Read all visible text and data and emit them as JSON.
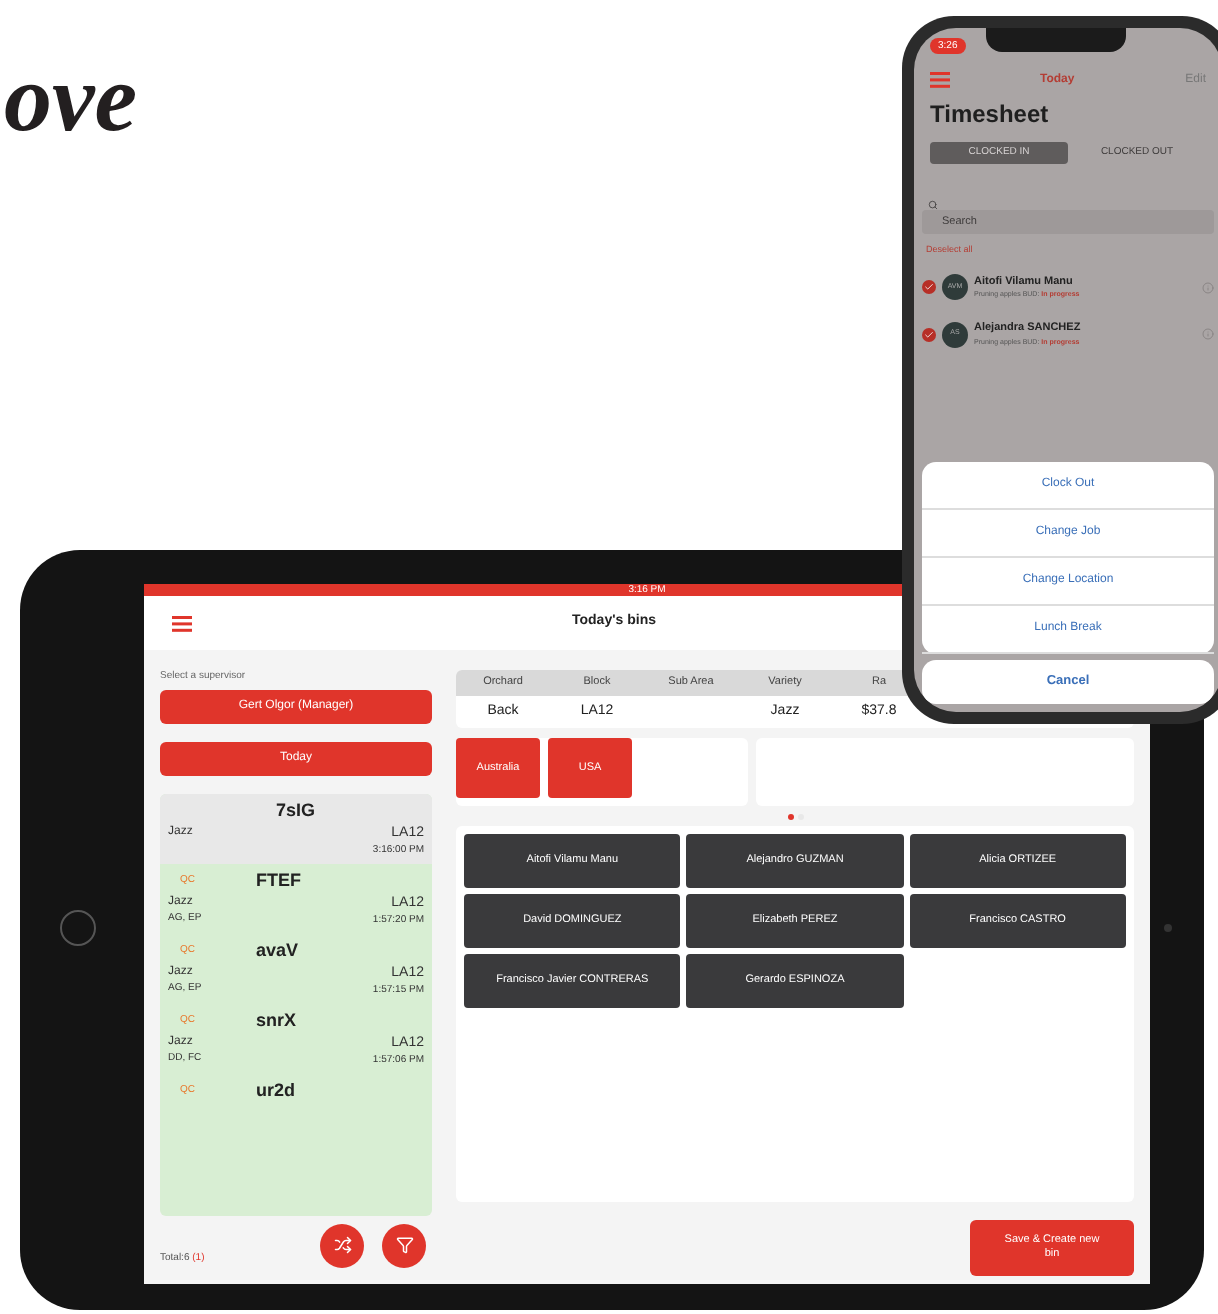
{
  "headline": {
    "lines": [
      "ove"
    ]
  },
  "tablet": {
    "status_time": "3:16 PM",
    "title": "Today's bins",
    "supervisor_label": "Select a supervisor",
    "supervisor": "Gert Olgor (Manager)",
    "date_button": "Today",
    "bins": [
      {
        "code": "7sIG",
        "variety": "Jazz",
        "block": "LA12",
        "time": "3:16:00 PM",
        "highlighted": false
      },
      {
        "tag": "QC",
        "code": "FTEF",
        "variety": "Jazz",
        "pickers": "AG, EP",
        "block": "LA12",
        "time": "1:57:20 PM",
        "highlighted": true
      },
      {
        "tag": "QC",
        "code": "avaV",
        "variety": "Jazz",
        "pickers": "AG, EP",
        "block": "LA12",
        "time": "1:57:15 PM",
        "highlighted": true
      },
      {
        "tag": "QC",
        "code": "snrX",
        "variety": "Jazz",
        "pickers": "DD, FC",
        "block": "LA12",
        "time": "1:57:06 PM",
        "highlighted": true
      },
      {
        "tag": "QC",
        "code": "ur2d",
        "highlighted": true
      }
    ],
    "total": "Total:6",
    "total_count": "(1)",
    "table": {
      "columns": [
        "Orchard",
        "Block",
        "Sub Area",
        "Variety",
        "Ra"
      ],
      "rows": [
        [
          "Back",
          "LA12",
          "",
          "Jazz",
          "$37.8"
        ]
      ]
    },
    "countries": [
      "Australia",
      "USA"
    ],
    "pager": [
      {
        "selected": true
      },
      {
        "selected": false
      }
    ],
    "workers": [
      "Aitofi Vilamu Manu",
      "Alejandro GUZMAN",
      "Alicia ORTIZEE",
      "David DOMINGUEZ",
      "Elizabeth PEREZ",
      "Francisco CASTRO",
      "Francisco Javier CONTRERAS",
      "Gerardo ESPINOZA"
    ],
    "save_button": "Save & Create new bin"
  },
  "phone": {
    "status_time": "3:26",
    "nav_title": "Today",
    "edit": "Edit",
    "title": "Timesheet",
    "segments": [
      {
        "label": "CLOCKED IN",
        "selected": true
      },
      {
        "label": "CLOCKED OUT",
        "selected": false
      }
    ],
    "search_placeholder": "Search",
    "deselect": "Deselect all",
    "people": [
      {
        "initials": "AVM",
        "name": "Aitofi Vilamu Manu",
        "detail": "Pruning apples BUD:",
        "status": "In progress",
        "checked": true
      },
      {
        "initials": "AS",
        "name": "Alejandra SANCHEZ",
        "detail": "Pruning apples BUD:",
        "status": "In progress",
        "checked": true
      }
    ],
    "actions": [
      "Clock Out",
      "Change Job",
      "Change Location",
      "Lunch Break"
    ],
    "cancel": "Cancel"
  }
}
